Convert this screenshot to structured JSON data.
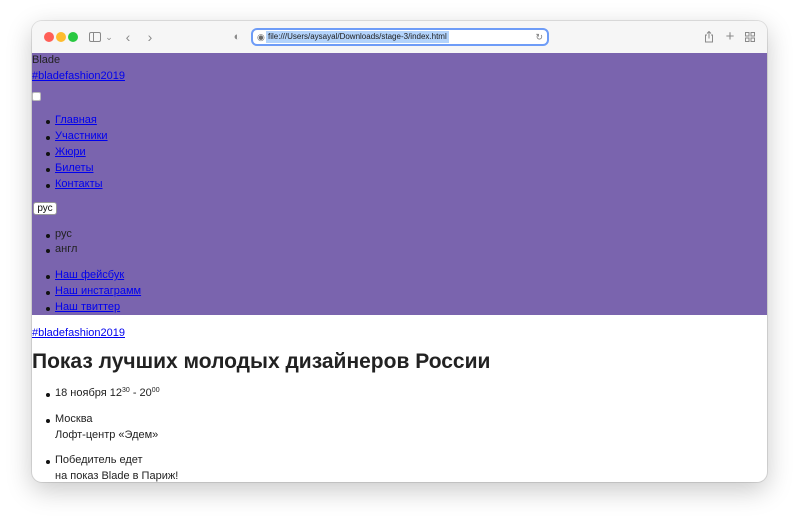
{
  "browser": {
    "url": "file:///Users/aysayal/Downloads/stage-3/index.html"
  },
  "header": {
    "logo": "Blade",
    "hashtag": "#bladefashion2019",
    "nav": [
      "Главная",
      "Участники",
      "Жюри",
      "Билеты",
      "Контакты"
    ],
    "lang_button": "рус",
    "lang_options": [
      "рус",
      "англ"
    ],
    "social": [
      "Наш фейсбук",
      "Наш инстаграмм",
      "Наш твиттер"
    ],
    "color": "#7a64ae"
  },
  "main": {
    "hashtag": "#bladefashion2019",
    "title": "Показ лучших молодых дизайнеров России",
    "info": {
      "date_text": "18 ноября 12",
      "start_min": "30",
      "separator": " - 20",
      "end_min": "00",
      "city": "Москва",
      "venue": "Лофт-центр «Эдем»",
      "prize_line1": "Победитель едет",
      "prize_line2": "на показ Blade в Париж!"
    }
  }
}
